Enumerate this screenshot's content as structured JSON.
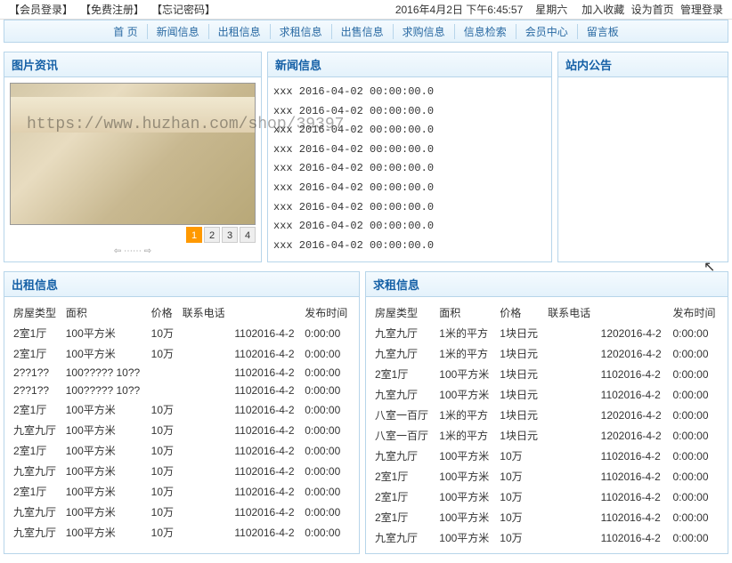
{
  "topbar": {
    "left": [
      {
        "label": "【会员登录】",
        "name": "member-login-link"
      },
      {
        "label": "【免费注册】",
        "name": "free-register-link"
      },
      {
        "label": "【忘记密码】",
        "name": "forgot-password-link"
      }
    ],
    "datetime": "2016年4月2日 下午6:45:57",
    "weekday": "星期六",
    "right": [
      {
        "label": "加入收藏",
        "name": "add-favorite-link"
      },
      {
        "label": "设为首页",
        "name": "set-homepage-link"
      },
      {
        "label": "管理登录",
        "name": "admin-login-link"
      }
    ]
  },
  "nav": [
    {
      "label": "首 页",
      "name": "nav-home"
    },
    {
      "label": "新闻信息",
      "name": "nav-news"
    },
    {
      "label": "出租信息",
      "name": "nav-rent-out"
    },
    {
      "label": "求租信息",
      "name": "nav-rent-want"
    },
    {
      "label": "出售信息",
      "name": "nav-sale"
    },
    {
      "label": "求购信息",
      "name": "nav-buy"
    },
    {
      "label": "信息检索",
      "name": "nav-search"
    },
    {
      "label": "会员中心",
      "name": "nav-member"
    },
    {
      "label": "留言板",
      "name": "nav-guestbook"
    }
  ],
  "panels": {
    "photo_title": "图片资讯",
    "news_title": "新闻信息",
    "notice_title": "站内公告",
    "rent_out_title": "出租信息",
    "rent_want_title": "求租信息"
  },
  "pager": [
    "1",
    "2",
    "3",
    "4"
  ],
  "pager_active": 0,
  "scroller": "⇦ ⋯⋯ ⇨",
  "news": [
    "xxx 2016-04-02 00:00:00.0",
    "xxx 2016-04-02 00:00:00.0",
    "xxx 2016-04-02 00:00:00.0",
    "xxx 2016-04-02 00:00:00.0",
    "xxx 2016-04-02 00:00:00.0",
    "xxx 2016-04-02 00:00:00.0",
    "xxx 2016-04-02 00:00:00.0",
    "xxx 2016-04-02 00:00:00.0",
    "xxx 2016-04-02 00:00:00.0"
  ],
  "rent_out": {
    "headers": [
      "房屋类型",
      "面积",
      "价格",
      "联系电话",
      "",
      "发布时间"
    ],
    "rows": [
      [
        "2室1厅",
        "100平方米",
        "10万",
        "",
        "1102016-4-2",
        "0:00:00"
      ],
      [
        "2室1厅",
        "100平方米",
        "10万",
        "",
        "1102016-4-2",
        "0:00:00"
      ],
      [
        "2??1??",
        "100????? 10??",
        "",
        "",
        "1102016-4-2",
        "0:00:00"
      ],
      [
        "2??1??",
        "100????? 10??",
        "",
        "",
        "1102016-4-2",
        "0:00:00"
      ],
      [
        "2室1厅",
        "100平方米",
        "10万",
        "",
        "1102016-4-2",
        "0:00:00"
      ],
      [
        "九室九厅",
        "100平方米",
        "10万",
        "",
        "1102016-4-2",
        "0:00:00"
      ],
      [
        "2室1厅",
        "100平方米",
        "10万",
        "",
        "1102016-4-2",
        "0:00:00"
      ],
      [
        "九室九厅",
        "100平方米",
        "10万",
        "",
        "1102016-4-2",
        "0:00:00"
      ],
      [
        "2室1厅",
        "100平方米",
        "10万",
        "",
        "1102016-4-2",
        "0:00:00"
      ],
      [
        "九室九厅",
        "100平方米",
        "10万",
        "",
        "1102016-4-2",
        "0:00:00"
      ],
      [
        "九室九厅",
        "100平方米",
        "10万",
        "",
        "1102016-4-2",
        "0:00:00"
      ]
    ]
  },
  "rent_want": {
    "headers": [
      "房屋类型",
      "面积",
      "价格",
      "联系电话",
      "",
      "发布时间"
    ],
    "rows": [
      [
        "九室九厅",
        "1米的平方",
        "1块日元",
        "",
        "1202016-4-2",
        "0:00:00"
      ],
      [
        "九室九厅",
        "1米的平方",
        "1块日元",
        "",
        "1202016-4-2",
        "0:00:00"
      ],
      [
        "2室1厅",
        "100平方米",
        "1块日元",
        "",
        "1102016-4-2",
        "0:00:00"
      ],
      [
        "九室九厅",
        "100平方米",
        "1块日元",
        "",
        "1102016-4-2",
        "0:00:00"
      ],
      [
        "八室一百厅",
        "1米的平方",
        "1块日元",
        "",
        "1202016-4-2",
        "0:00:00"
      ],
      [
        "八室一百厅",
        "1米的平方",
        "1块日元",
        "",
        "1202016-4-2",
        "0:00:00"
      ],
      [
        "九室九厅",
        "100平方米",
        "10万",
        "",
        "1102016-4-2",
        "0:00:00"
      ],
      [
        "2室1厅",
        "100平方米",
        "10万",
        "",
        "1102016-4-2",
        "0:00:00"
      ],
      [
        "2室1厅",
        "100平方米",
        "10万",
        "",
        "1102016-4-2",
        "0:00:00"
      ],
      [
        "2室1厅",
        "100平方米",
        "10万",
        "",
        "1102016-4-2",
        "0:00:00"
      ],
      [
        "九室九厅",
        "100平方米",
        "10万",
        "",
        "1102016-4-2",
        "0:00:00"
      ]
    ]
  },
  "watermark": "https://www.huzhan.com/shop/39397"
}
